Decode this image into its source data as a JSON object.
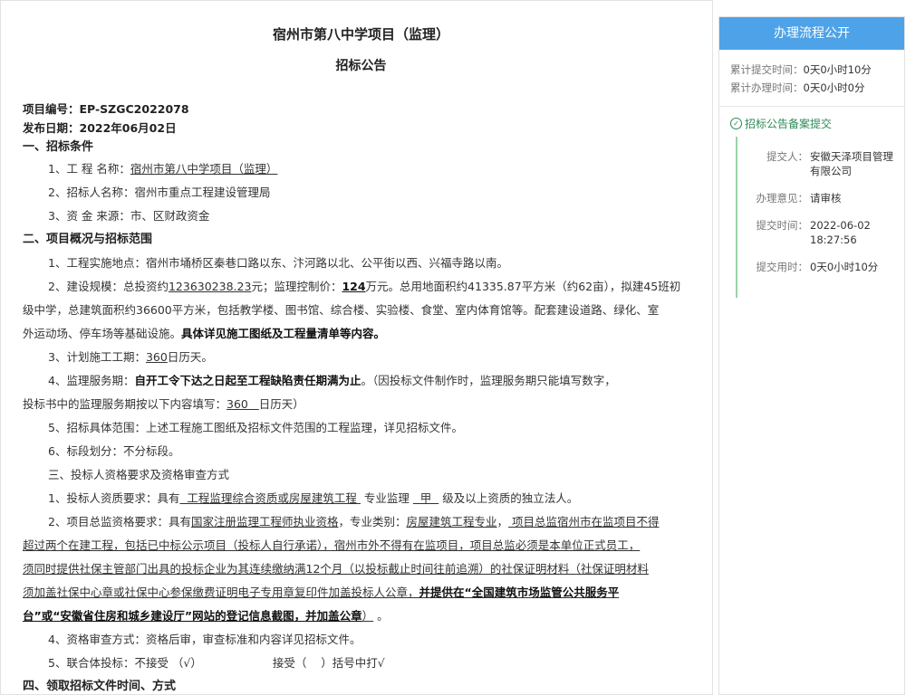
{
  "document": {
    "title": "宿州市第八中学项目（监理）",
    "subtitle": "招标公告",
    "project_no": "项目编号：EP-SZGC2022078",
    "publish_date": "发布日期：2022年06月02日",
    "s1_title": "一、招标条件",
    "s1_l1_pre": "1、工 程 名称：",
    "s1_l1_val": "宿州市第八中学项目（监理）",
    "s1_l2": "2、招标人名称：宿州市重点工程建设管理局",
    "s1_l3": "3、资 金 来源：市、区财政资金",
    "s2_title": "二、项目概况与招标范围",
    "s2_l1": "1、工程实施地点：宿州市埇桥区秦巷口路以东、汴河路以北、公平街以西、兴福寺路以南。",
    "s2_l2_a": "2、建设规模：总投资约",
    "s2_l2_b": "123630238.23",
    "s2_l2_c": "元；监理控制价：",
    "s2_l2_d": "124",
    "s2_l2_e": "万元。总用地面积约41335.87平方米（约62亩），拟建45班初",
    "s2_l2_line2": "级中学，总建筑面积约36600平方米，包括教学楼、图书馆、综合楼、实验楼、食堂、室内体育馆等。配套建设道路、绿化、室",
    "s2_l2_line3a": "外运动场、停车场等基础设施。",
    "s2_l2_line3b": "具体详见施工图纸及工程量清单等内容。",
    "s2_l3_a": "3、计划施工工期：",
    "s2_l3_b": "360",
    "s2_l3_c": "日历天。",
    "s2_l4_a": "4、监理服务期：",
    "s2_l4_b": "自开工令下达之日起至工程缺陷责任期满为止",
    "s2_l4_c": "。（因投标文件制作时，监理服务期只能填写数字，",
    "s2_l4_line2a": "投标书中的监理服务期按以下内容填写：",
    "s2_l4_line2b": "360   ",
    "s2_l4_line2c": "日历天）",
    "s2_l5": "5、招标具体范围：上述工程施工图纸及招标文件范围的工程监理，详见招标文件。",
    "s2_l6": "6、标段划分：不分标段。",
    "s3_title": "三、投标人资格要求及资格审查方式",
    "s3_l1_a": "1、投标人资质要求：具有",
    "s3_l1_b": "  工程监理综合资质或房屋建筑工程 ",
    "s3_l1_c": " 专业监理 ",
    "s3_l1_d": "  甲  ",
    "s3_l1_e": " 级及以上资质的独立法人。",
    "s3_l2_a": "2、项目总监资格要求：具有",
    "s3_l2_b": "国家注册监理工程师执业资格",
    "s3_l2_c": "，专业类别：",
    "s3_l2_d": "房屋建筑工程专业",
    "s3_l2_e": "，",
    "s3_l2_f": " 项目总监宿州市在监项目不得",
    "s3_l2_line2": "超过两个在建工程，包括已中标公示项目（投标人自行承诺），宿州市外不得有在监项目，项目总监必须是本单位正式员工，",
    "s3_l2_line3": "须同时提供社保主管部门出具的投标企业为其连续缴纳满12个月（以投标截止时间往前追溯）的社保证明材料（社保证明材料",
    "s3_l2_line4a": "须加盖社保中心章或社保中心参保缴费证明电子专用章复印件加盖投标人公章，",
    "s3_l2_line4b": "并提供在“全国建筑市场监管公共服务平",
    "s3_l2_line5a": "台”或“安徽省住房和城乡建设厅”网站的登记信息截图，",
    "s3_l2_line5b": "并加盖公章",
    "s3_l2_line5c": "）",
    "s3_l2_line5d": " 。",
    "s3_l4": "4、资格审查方式：资格后审，审查标准和内容详见招标文件。",
    "s3_l5_a": "5、联合体投标：不接受 （√）",
    "s3_l5_b": "接受（    ）括号中打√",
    "s4_title": "四、领取招标文件时间、方式"
  },
  "sidebar": {
    "header": "办理流程公开",
    "total_submit_label": "累计提交时间：",
    "total_submit_value": "0天0小时10分",
    "total_process_label": "累计办理时间：",
    "total_process_value": "0天0小时0分",
    "step_title": "招标公告备案提交",
    "submitter_label": "提交人：",
    "submitter_value": "安徽天泽项目管理有限公司",
    "opinion_label": "办理意见：",
    "opinion_value": "请审核",
    "submit_time_label": "提交时间：",
    "submit_time_value": "2022-06-02 18:27:56",
    "submit_used_label": "提交用时：",
    "submit_used_value": "0天0小时10分"
  },
  "colors": {
    "header_bg": "#4ea3e8",
    "step_green": "#2e8b57",
    "timeline": "#9ad3a8"
  },
  "icons": {
    "step_icon": "check-circle-icon"
  }
}
